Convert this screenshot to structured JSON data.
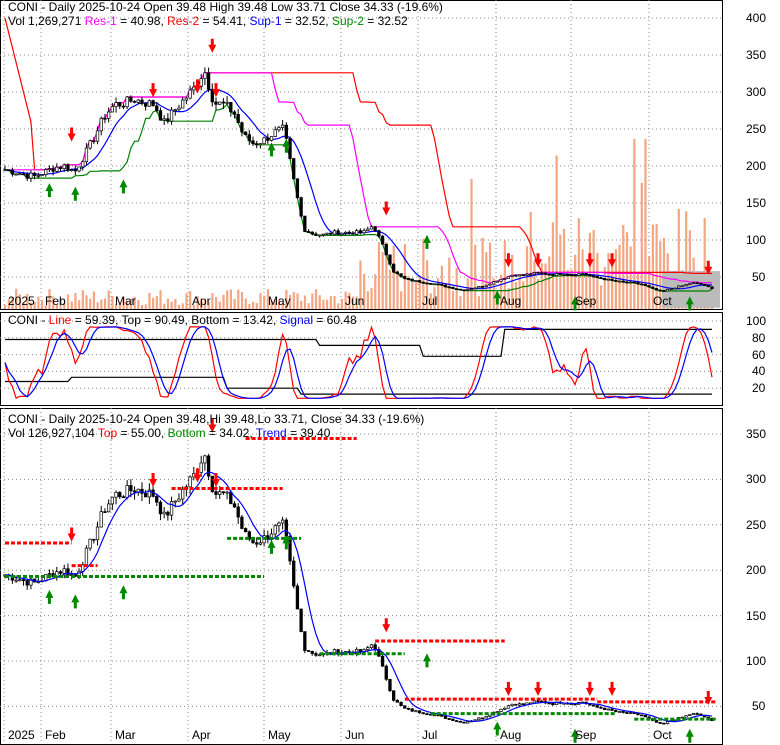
{
  "top_header": {
    "line1": "CONI - Daily 2025-10-24 Open 39.48  High 39.48  Low 33.71  Close 34.33 (-19.6%)",
    "vol": "Vol 1,269,271",
    "res1_label": "Res-1",
    "res1_val": " = 40.98, ",
    "res2_label": "Res-2",
    "res2_val": " = 54.41, ",
    "sup1_label": "Sup-1",
    "sup1_val": " = 32.52, ",
    "sup2_label": "Sup-2",
    "sup2_val": " = 32.52"
  },
  "mid_header": {
    "prefix": "CONI - ",
    "line_label": "Line",
    "rest": " = 59.39, Top = 90.49, Bottom = 13.42, ",
    "signal_label": "Signal",
    "signal_val": " = 60.48"
  },
  "bot_header": {
    "line1": "CONI - Daily 2025-10-24 Open 39.48,Hi 39.48,Lo 33.71, Close 34.33 (-19.6%)",
    "vol": "Vol 126,927,104 ",
    "top_label": "Top",
    "top_val": " = 55.00, ",
    "bottom_label": "Bottom",
    "bottom_val": " = 34.02, ",
    "trend_label": "Trend",
    "trend_val": " = 39.40"
  },
  "colors": {
    "res1": "#ff00ff",
    "res2": "#ff0000",
    "sup1": "#0000ff",
    "sup2": "#008000",
    "volume": "#f4a582"
  },
  "chart_data": [
    {
      "type": "candlestick",
      "title": "CONI - Daily (support/resistance)",
      "x_ticks": [
        "2025",
        "Feb",
        "Mar",
        "Apr",
        "May",
        "Jun",
        "Jul",
        "Aug",
        "Sep",
        "Oct"
      ],
      "y_ticks": [
        50,
        100,
        150,
        200,
        250,
        300,
        350,
        400
      ],
      "ylim": [
        30,
        400
      ],
      "closes_approx": [
        195,
        192,
        188,
        186,
        192,
        198,
        200,
        192,
        215,
        240,
        268,
        283,
        285,
        290,
        286,
        283,
        258,
        275,
        290,
        305,
        330,
        285,
        283,
        272,
        240,
        230,
        235,
        245,
        250,
        180,
        115,
        108,
        107,
        110,
        110,
        110,
        110,
        120,
        90,
        58,
        48,
        45,
        43,
        41,
        38,
        35,
        32,
        35,
        38,
        43,
        48,
        53,
        52,
        55,
        55,
        53,
        55,
        53,
        55,
        50,
        48,
        45,
        43,
        42,
        40,
        34,
        30,
        35,
        38,
        42,
        40,
        34
      ]
    },
    {
      "type": "line",
      "title": "CONI oscillator",
      "series": [
        "Line",
        "Signal",
        "Top",
        "Bottom"
      ],
      "y_ticks": [
        20,
        40,
        60,
        80,
        100
      ],
      "ylim": [
        0,
        100
      ]
    },
    {
      "type": "candlestick",
      "title": "CONI - Daily (trend)",
      "y_ticks": [
        50,
        100,
        150,
        200,
        250,
        300,
        350
      ],
      "ylim": [
        30,
        360
      ]
    }
  ]
}
